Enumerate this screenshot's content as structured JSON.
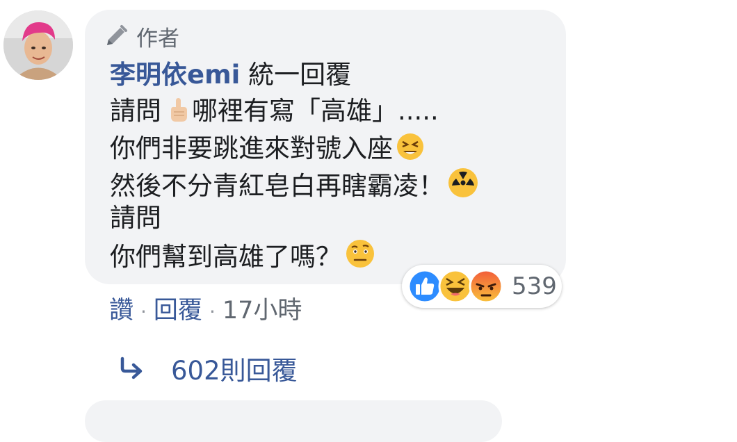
{
  "comment": {
    "badge": "作者",
    "author_name": "李明依emi",
    "lines": [
      " 統一回覆",
      "請問",
      "哪裡有寫「高雄」.....",
      "你們非要跳進來對號入座",
      "然後不分青紅皂白再瞎霸凌！",
      "請問",
      "你們幫到高雄了嗎？"
    ],
    "reaction_count": "539",
    "reaction_icons": [
      "like-icon",
      "haha-icon",
      "angry-icon"
    ]
  },
  "actions": {
    "like": "讚",
    "reply": "回覆",
    "time": "17小時"
  },
  "replies": {
    "label": "602則回覆"
  },
  "colors": {
    "bubble": "#f2f3f5",
    "link": "#385898",
    "text": "#1c1e21",
    "meta": "#606770",
    "like": "#2d8cff"
  }
}
